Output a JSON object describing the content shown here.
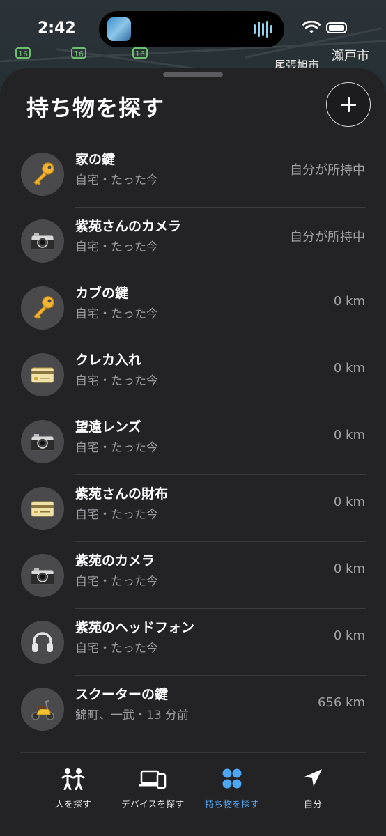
{
  "status_bar": {
    "time": "2:42"
  },
  "map": {
    "labels": [
      "尾張旭市",
      "瀬戸市"
    ],
    "route_shields": [
      "16",
      "16",
      "16"
    ]
  },
  "header": {
    "title": "持ち物を探す"
  },
  "items": [
    {
      "name": "家の鍵",
      "location": "自宅・たった今",
      "distance": "自分が所持中",
      "icon": "key-icon"
    },
    {
      "name": "紫苑さんのカメラ",
      "location": "自宅・たった今",
      "distance": "自分が所持中",
      "icon": "camera-icon"
    },
    {
      "name": "カブの鍵",
      "location": "自宅・たった今",
      "distance": "0 km",
      "icon": "key-icon"
    },
    {
      "name": "クレカ入れ",
      "location": "自宅・たった今",
      "distance": "0 km",
      "icon": "credit-card-icon"
    },
    {
      "name": "望遠レンズ",
      "location": "自宅・たった今",
      "distance": "0 km",
      "icon": "camera-icon"
    },
    {
      "name": "紫苑さんの財布",
      "location": "自宅・たった今",
      "distance": "0 km",
      "icon": "credit-card-icon"
    },
    {
      "name": "紫苑のカメラ",
      "location": "自宅・たった今",
      "distance": "0 km",
      "icon": "camera-icon"
    },
    {
      "name": "紫苑のヘッドフォン",
      "location": "自宅・たった今",
      "distance": "0 km",
      "icon": "headphones-icon"
    },
    {
      "name": "スクーターの鍵",
      "location": "錦町、一武・13 分前",
      "distance": "656 km",
      "icon": "scooter-icon"
    }
  ],
  "tabs": [
    {
      "label": "人を探す",
      "icon": "people-icon",
      "active": false
    },
    {
      "label": "デバイスを探す",
      "icon": "devices-icon",
      "active": false
    },
    {
      "label": "持ち物を探す",
      "icon": "items-icon",
      "active": true
    },
    {
      "label": "自分",
      "icon": "location-arrow-icon",
      "active": false
    }
  ],
  "colors": {
    "accent": "#4ea6f5",
    "sheet": "#232325",
    "secondary_text": "#9a9aa0"
  }
}
